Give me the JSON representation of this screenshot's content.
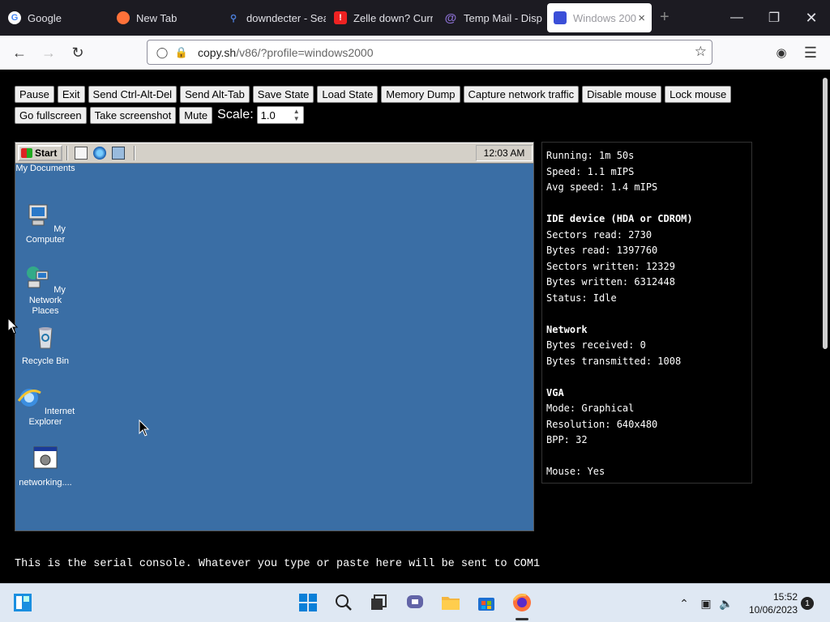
{
  "browser": {
    "tabs": [
      {
        "label": "Google",
        "icon": "google-icon"
      },
      {
        "label": "New Tab",
        "icon": "firefox-icon"
      },
      {
        "label": "downdecter - Sea",
        "icon": "search-icon"
      },
      {
        "label": "Zelle down? Curr",
        "icon": "alert-icon"
      },
      {
        "label": "Temp Mail - Disp",
        "icon": "at-icon"
      },
      {
        "label": "Windows 200",
        "icon": "v86-icon",
        "active": true
      }
    ],
    "url_host": "copy.sh",
    "url_path": "/v86/?profile=windows2000"
  },
  "controls": {
    "buttons": [
      "Pause",
      "Exit",
      "Send Ctrl-Alt-Del",
      "Send Alt-Tab",
      "Save State",
      "Load State",
      "Memory Dump",
      "Capture network traffic",
      "Disable mouse",
      "Lock mouse",
      "Go fullscreen",
      "Take screenshot",
      "Mute"
    ],
    "scale_label": "Scale:",
    "scale_value": "1.0"
  },
  "emulator": {
    "start_label": "Start",
    "clock": "12:03 AM",
    "desktop_icons": [
      {
        "label": "My Documents"
      },
      {
        "label": "My Computer"
      },
      {
        "label": "My Network Places"
      },
      {
        "label": "Recycle Bin"
      },
      {
        "label": "Internet Explorer"
      },
      {
        "label": "networking...."
      }
    ]
  },
  "stats": {
    "lines": [
      "Running: 1m 50s",
      "Speed: 1.1 mIPS",
      "Avg speed: 1.4 mIPS",
      "",
      "IDE device (HDA or CDROM)",
      "Sectors read: 2730",
      "Bytes read: 1397760",
      "Sectors written: 12329",
      "Bytes written: 6312448",
      "Status: Idle",
      "",
      "Network",
      "Bytes received: 0",
      "Bytes transmitted: 1008",
      "",
      "VGA",
      "Mode: Graphical",
      "Resolution: 640x480",
      "BPP: 32",
      "",
      "Mouse: Yes"
    ],
    "bold_lines": [
      4,
      11,
      15
    ]
  },
  "serial_console": "This is the serial console. Whatever you type or paste here will be sent to COM1",
  "taskbar": {
    "time": "15:52",
    "date": "10/06/2023",
    "notifications": "1"
  }
}
